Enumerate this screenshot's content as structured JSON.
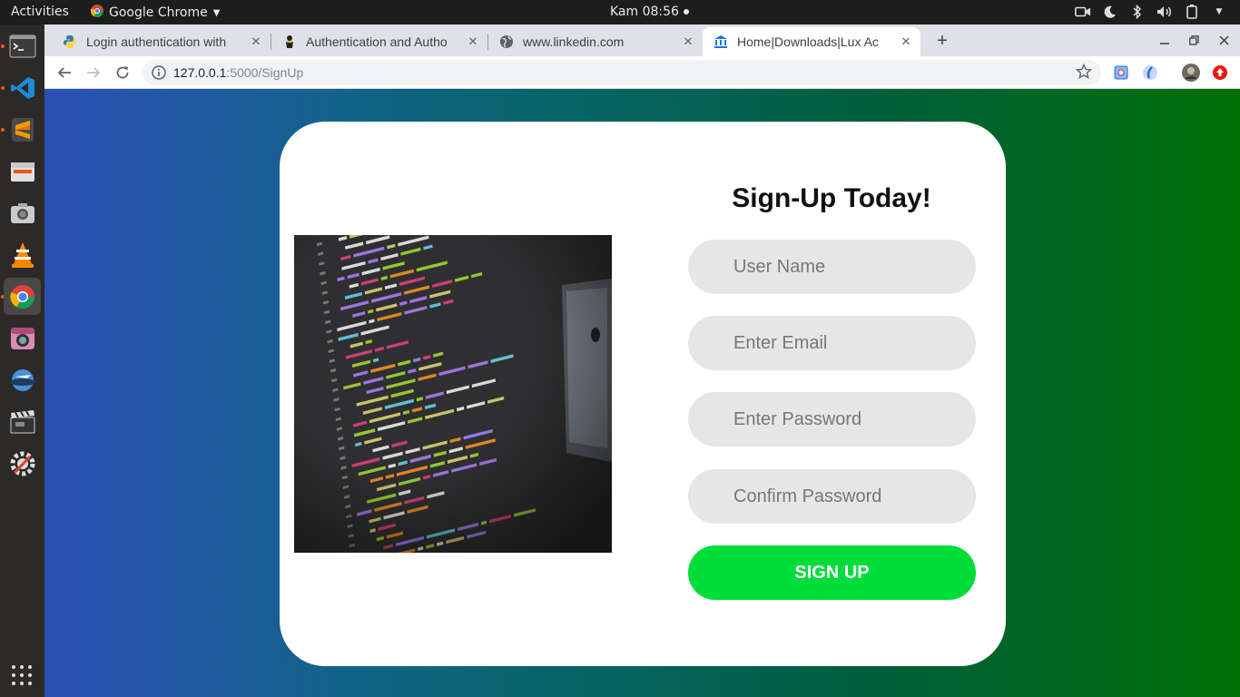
{
  "topbar": {
    "activities": "Activities",
    "app_name": "Google Chrome",
    "clock": "Kam 08:56"
  },
  "dock": {
    "items": [
      "terminal-icon",
      "vscode-icon",
      "sublime-text-icon",
      "files-icon",
      "screenshot-icon",
      "vlc-icon",
      "chrome-icon",
      "camera-icon",
      "flightgear-icon",
      "video-editor-icon",
      "settings-icon"
    ],
    "active": "chrome-icon"
  },
  "browser": {
    "tabs": [
      {
        "title": "Login authentication with",
        "favicon": "python-icon",
        "active": false
      },
      {
        "title": "Authentication and Autho",
        "favicon": "flask-icon",
        "active": false
      },
      {
        "title": "www.linkedin.com",
        "favicon": "globe-icon",
        "active": false
      },
      {
        "title": "Home|Downloads|Lux Ac",
        "favicon": "bank-icon",
        "active": true
      }
    ],
    "url_host": "127.0.0.1",
    "url_path": ":5000/SignUp"
  },
  "page": {
    "colors": {
      "gradient_start": "#2c4fb6",
      "gradient_end": "#007106",
      "button": "#00dd3a",
      "field_bg": "#e6e6e6"
    },
    "title": "Sign-Up Today!",
    "fields": {
      "username_placeholder": "User Name",
      "email_placeholder": "Enter Email",
      "password_placeholder": "Enter Password",
      "confirm_placeholder": "Confirm Password"
    },
    "button_label": "SIGN UP"
  }
}
